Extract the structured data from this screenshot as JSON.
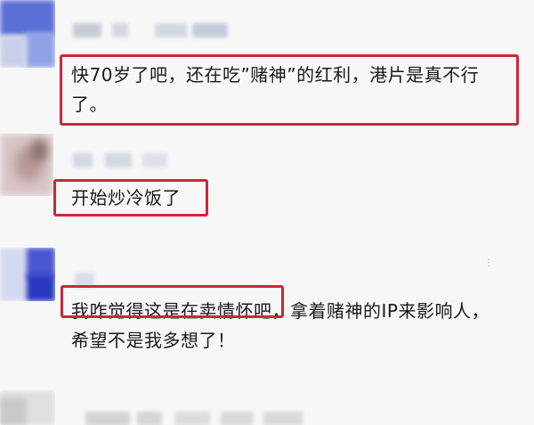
{
  "comments": [
    {
      "id": "c1",
      "lines": [
        "快70岁了吧，还在吃”赌神”的红利，港片是真不行",
        "了。"
      ]
    },
    {
      "id": "c2",
      "lines": [
        "开始炒冷饭了"
      ]
    },
    {
      "id": "c3",
      "lines": [
        "我咋觉得这是在卖情怀吧，拿着赌神的IP来影响人，",
        "希望不是我多想了！"
      ]
    }
  ],
  "highlight_color": "#c8283a"
}
